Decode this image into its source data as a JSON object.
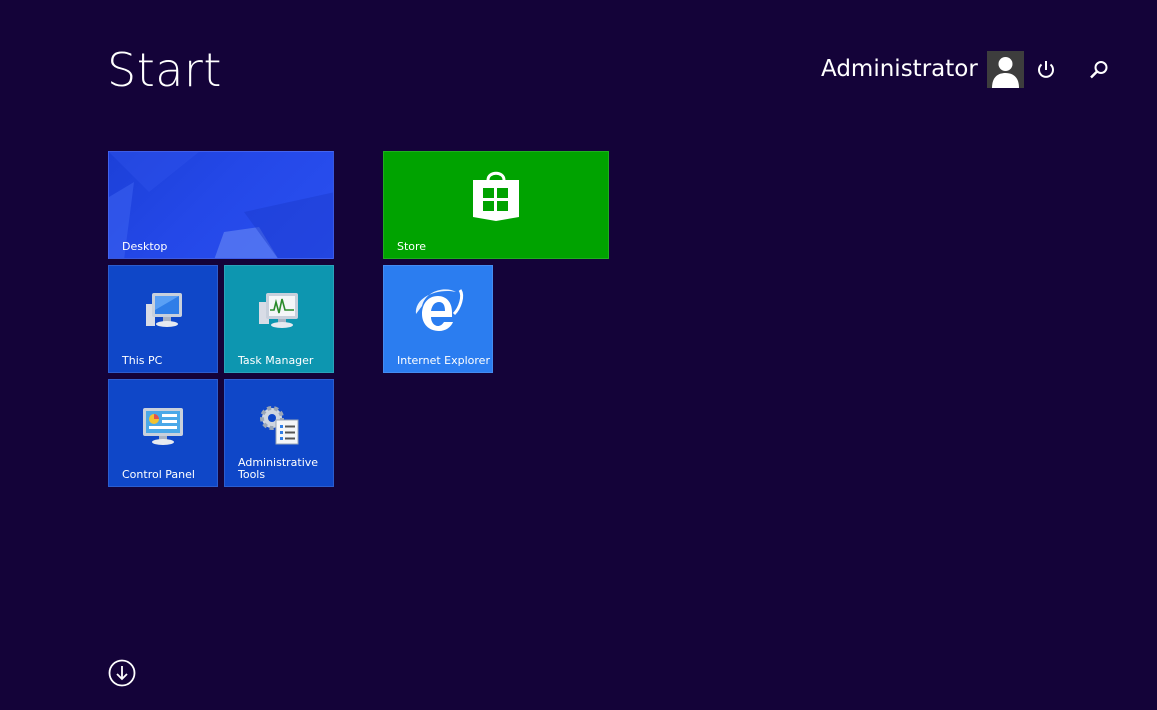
{
  "start": {
    "title": "Start"
  },
  "user": {
    "name": "Administrator",
    "avatar_icon": "user-avatar-icon"
  },
  "controls": {
    "power_icon": "power-icon",
    "search_icon": "search-icon",
    "apps_icon": "down-arrow-circle-icon"
  },
  "tiles": {
    "desktop": {
      "label": "Desktop",
      "color": "#2448e8"
    },
    "store": {
      "label": "Store",
      "color": "#00a300",
      "icon": "store-bag-icon"
    },
    "this_pc": {
      "label": "This PC",
      "color": "#0f47c8",
      "icon": "computer-icon"
    },
    "task_manager": {
      "label": "Task Manager",
      "color": "#0d96b0",
      "icon": "task-manager-icon"
    },
    "internet_explorer": {
      "label": "Internet Explorer",
      "color": "#2b7df0",
      "icon": "internet-explorer-icon"
    },
    "control_panel": {
      "label": "Control Panel",
      "color": "#0f47c8",
      "icon": "control-panel-icon"
    },
    "administrative_tools": {
      "label": "Administrative\nTools",
      "color": "#0f47c8",
      "icon": "admin-tools-icon"
    }
  },
  "colors": {
    "background": "#140339"
  }
}
